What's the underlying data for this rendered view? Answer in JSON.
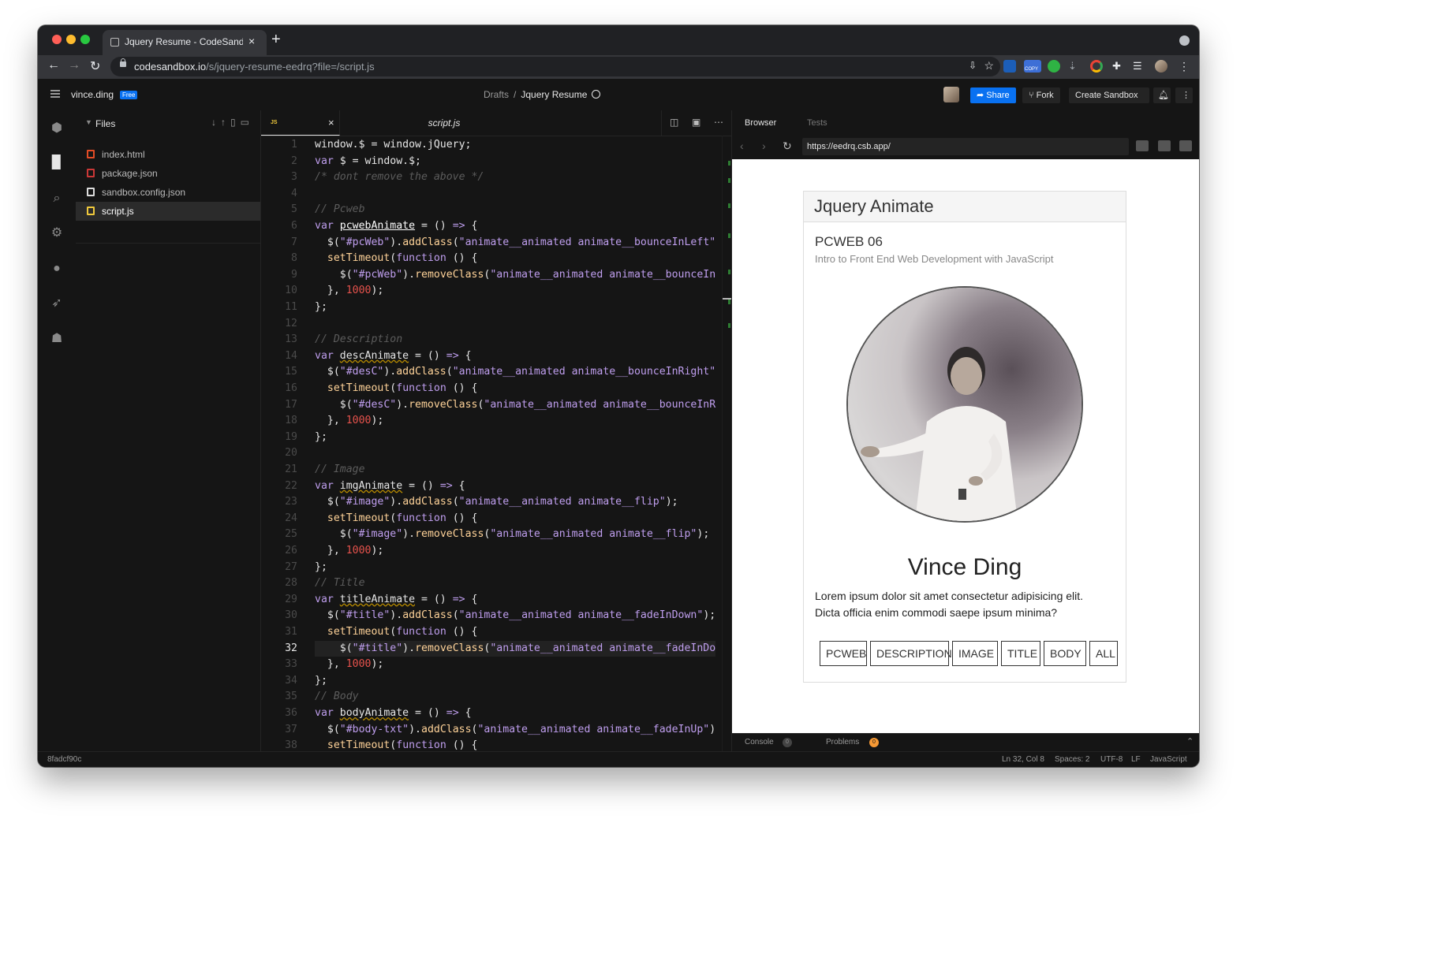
{
  "browser": {
    "tab_title": "Jquery Resume - CodeSandbox",
    "tab_close": "×",
    "new_tab": "+",
    "url_host": "codesandbox.io",
    "url_path": "/s/jquery-resume-eedrq?file=/script.js",
    "copy_badge": "COPY"
  },
  "header": {
    "username": "vince.ding",
    "plan_badge": "Free",
    "crumb_parent": "Drafts",
    "crumb_sep": "/",
    "crumb_current": "Jquery Resume",
    "share_label": "Share",
    "fork_label": "Fork",
    "create_label": "Create Sandbox"
  },
  "explorer": {
    "title": "Files",
    "files": [
      {
        "name": "index.html",
        "icon": "html-file-icon",
        "color": "#e34c26"
      },
      {
        "name": "package.json",
        "icon": "npm-file-icon",
        "color": "#cb3837"
      },
      {
        "name": "sandbox.config.json",
        "icon": "cube-icon",
        "color": "#dddddd"
      },
      {
        "name": "script.js",
        "icon": "js-file-icon",
        "color": "#f0c93c"
      }
    ]
  },
  "editor": {
    "tab_badge": "JS",
    "tab_name": "script.js",
    "tab_close": "×",
    "cursor_line": 32,
    "lines": [
      [
        [
          "plain",
          "window.$ = window.jQuery;"
        ]
      ],
      [
        [
          "kw",
          "var "
        ],
        [
          "plain",
          "$ = window.$;"
        ]
      ],
      [
        [
          "cmt",
          "/* dont remove the above */"
        ]
      ],
      [
        [
          "plain",
          ""
        ]
      ],
      [
        [
          "cmt",
          "// Pcweb"
        ]
      ],
      [
        [
          "kw",
          "var "
        ],
        [
          "var2",
          "pcwebAnimate"
        ],
        [
          "plain",
          " = () "
        ],
        [
          "kw",
          "=>"
        ],
        [
          "plain",
          " {"
        ]
      ],
      [
        [
          "plain",
          "  $("
        ],
        [
          "str",
          "\"#pcWeb\""
        ],
        [
          "plain",
          ")."
        ],
        [
          "fn",
          "addClass"
        ],
        [
          "plain",
          "("
        ],
        [
          "str",
          "\"animate__animated animate__bounceInLeft\""
        ]
      ],
      [
        [
          "plain",
          "  "
        ],
        [
          "fn",
          "setTimeout"
        ],
        [
          "plain",
          "("
        ],
        [
          "kw",
          "function"
        ],
        [
          "plain",
          " () {"
        ]
      ],
      [
        [
          "plain",
          "    $("
        ],
        [
          "str",
          "\"#pcWeb\""
        ],
        [
          "plain",
          ")."
        ],
        [
          "fn",
          "removeClass"
        ],
        [
          "plain",
          "("
        ],
        [
          "str",
          "\"animate__animated animate__bounceIn"
        ]
      ],
      [
        [
          "plain",
          "  }, "
        ],
        [
          "num",
          "1000"
        ],
        [
          "plain",
          ");"
        ]
      ],
      [
        [
          "plain",
          "};"
        ]
      ],
      [
        [
          "plain",
          ""
        ]
      ],
      [
        [
          "cmt",
          "// Description"
        ]
      ],
      [
        [
          "kw",
          "var "
        ],
        [
          "var",
          "descAnimate"
        ],
        [
          "plain",
          " = () "
        ],
        [
          "kw",
          "=>"
        ],
        [
          "plain",
          " {"
        ]
      ],
      [
        [
          "plain",
          "  $("
        ],
        [
          "str",
          "\"#desC\""
        ],
        [
          "plain",
          ")."
        ],
        [
          "fn",
          "addClass"
        ],
        [
          "plain",
          "("
        ],
        [
          "str",
          "\"animate__animated animate__bounceInRight\""
        ]
      ],
      [
        [
          "plain",
          "  "
        ],
        [
          "fn",
          "setTimeout"
        ],
        [
          "plain",
          "("
        ],
        [
          "kw",
          "function"
        ],
        [
          "plain",
          " () {"
        ]
      ],
      [
        [
          "plain",
          "    $("
        ],
        [
          "str",
          "\"#desC\""
        ],
        [
          "plain",
          ")."
        ],
        [
          "fn",
          "removeClass"
        ],
        [
          "plain",
          "("
        ],
        [
          "str",
          "\"animate__animated animate__bounceInR"
        ]
      ],
      [
        [
          "plain",
          "  }, "
        ],
        [
          "num",
          "1000"
        ],
        [
          "plain",
          ");"
        ]
      ],
      [
        [
          "plain",
          "};"
        ]
      ],
      [
        [
          "plain",
          ""
        ]
      ],
      [
        [
          "cmt",
          "// Image"
        ]
      ],
      [
        [
          "kw",
          "var "
        ],
        [
          "var",
          "imgAnimate"
        ],
        [
          "plain",
          " = () "
        ],
        [
          "kw",
          "=>"
        ],
        [
          "plain",
          " {"
        ]
      ],
      [
        [
          "plain",
          "  $("
        ],
        [
          "str",
          "\"#image\""
        ],
        [
          "plain",
          ")."
        ],
        [
          "fn",
          "addClass"
        ],
        [
          "plain",
          "("
        ],
        [
          "str",
          "\"animate__animated animate__flip\""
        ],
        [
          "plain",
          ");"
        ]
      ],
      [
        [
          "plain",
          "  "
        ],
        [
          "fn",
          "setTimeout"
        ],
        [
          "plain",
          "("
        ],
        [
          "kw",
          "function"
        ],
        [
          "plain",
          " () {"
        ]
      ],
      [
        [
          "plain",
          "    $("
        ],
        [
          "str",
          "\"#image\""
        ],
        [
          "plain",
          ")."
        ],
        [
          "fn",
          "removeClass"
        ],
        [
          "plain",
          "("
        ],
        [
          "str",
          "\"animate__animated animate__flip\""
        ],
        [
          "plain",
          ");"
        ]
      ],
      [
        [
          "plain",
          "  }, "
        ],
        [
          "num",
          "1000"
        ],
        [
          "plain",
          ");"
        ]
      ],
      [
        [
          "plain",
          "};"
        ]
      ],
      [
        [
          "cmt",
          "// Title"
        ]
      ],
      [
        [
          "kw",
          "var "
        ],
        [
          "var",
          "titleAnimate"
        ],
        [
          "plain",
          " = () "
        ],
        [
          "kw",
          "=>"
        ],
        [
          "plain",
          " {"
        ]
      ],
      [
        [
          "plain",
          "  $("
        ],
        [
          "str",
          "\"#title\""
        ],
        [
          "plain",
          ")."
        ],
        [
          "fn",
          "addClass"
        ],
        [
          "plain",
          "("
        ],
        [
          "str",
          "\"animate__animated animate__fadeInDown\""
        ],
        [
          "plain",
          ");"
        ]
      ],
      [
        [
          "plain",
          "  "
        ],
        [
          "fn",
          "setTimeout"
        ],
        [
          "plain",
          "("
        ],
        [
          "kw",
          "function"
        ],
        [
          "plain",
          " () {"
        ]
      ],
      [
        [
          "plain",
          "    $("
        ],
        [
          "str",
          "\"#title\""
        ],
        [
          "plain",
          ")."
        ],
        [
          "fn",
          "removeClass"
        ],
        [
          "plain",
          "("
        ],
        [
          "str",
          "\"animate__animated animate__fadeInDo"
        ]
      ],
      [
        [
          "plain",
          "  }, "
        ],
        [
          "num",
          "1000"
        ],
        [
          "plain",
          ");"
        ]
      ],
      [
        [
          "plain",
          "};"
        ]
      ],
      [
        [
          "cmt",
          "// Body"
        ]
      ],
      [
        [
          "kw",
          "var "
        ],
        [
          "var",
          "bodyAnimate"
        ],
        [
          "plain",
          " = () "
        ],
        [
          "kw",
          "=>"
        ],
        [
          "plain",
          " {"
        ]
      ],
      [
        [
          "plain",
          "  $("
        ],
        [
          "str",
          "\"#body-txt\""
        ],
        [
          "plain",
          ")."
        ],
        [
          "fn",
          "addClass"
        ],
        [
          "plain",
          "("
        ],
        [
          "str",
          "\"animate__animated animate__fadeInUp\""
        ],
        [
          "plain",
          ")"
        ]
      ],
      [
        [
          "plain",
          "  "
        ],
        [
          "fn",
          "setTimeout"
        ],
        [
          "plain",
          "("
        ],
        [
          "kw",
          "function"
        ],
        [
          "plain",
          " () {"
        ]
      ]
    ]
  },
  "preview": {
    "tab_browser": "Browser",
    "tab_tests": "Tests",
    "url": "https://eedrq.csb.app/",
    "page": {
      "heading": "Jquery Animate",
      "course_code": "PCWEB 06",
      "course_desc": "Intro to Front End Web Development with JavaScript",
      "name": "Vince Ding",
      "lorem_1": "Lorem ipsum dolor sit amet consectetur adipisicing elit.",
      "lorem_2": "Dicta officia enim commodi saepe ipsum minima?",
      "buttons": [
        "PCWEB",
        "DESCRIPTION",
        "IMAGE",
        "TITLE",
        "BODY",
        "ALL"
      ]
    },
    "console_label": "Console",
    "console_count": "0",
    "problems_label": "Problems",
    "problems_count": "0"
  },
  "status": {
    "commit": "8fadcf90c",
    "cursor_pos": "Ln 32, Col 8",
    "spaces": "Spaces: 2",
    "encoding": "UTF-8",
    "eol": "LF",
    "language": "JavaScript"
  }
}
